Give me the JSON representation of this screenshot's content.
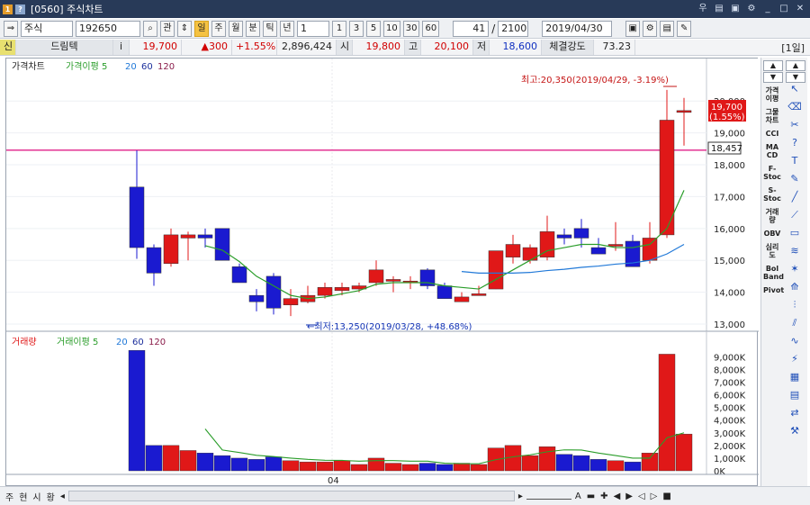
{
  "window": {
    "badge1": "1",
    "badge2": "?",
    "title": "[0560] 주식차트",
    "controls": [
      "우",
      "▤",
      "▣",
      "⚙",
      "_",
      "□",
      "✕"
    ]
  },
  "toolbar1": {
    "market": "주식",
    "code": "192650",
    "search_icon": "search-icon",
    "related": "관",
    "periods": [
      "일",
      "주",
      "월",
      "분",
      "틱",
      "년"
    ],
    "active_period": "일",
    "unit_value": "1",
    "quick_units": [
      "1",
      "3",
      "5",
      "10",
      "30",
      "60"
    ],
    "count": "41",
    "total": "2100",
    "date": "2019/04/30"
  },
  "toolbar2": {
    "flag": "신",
    "name": "드림텍",
    "info": "i",
    "price": "19,700",
    "change": "▲300",
    "rate": "+1.55%",
    "volume": "2,896,424",
    "open_label": "시",
    "open": "19,800",
    "high_label": "고",
    "high": "20,100",
    "low_label": "저",
    "low": "18,600",
    "strength_label": "체결강도",
    "strength": "73.23",
    "period_badge": "[1일]"
  },
  "price_panel": {
    "legend_main": "가격차트",
    "legend_ma": "가격이평 5",
    "ma20": "20",
    "ma60": "60",
    "ma120": "120",
    "y_ticks": [
      "20,000",
      "19,000",
      "18,000",
      "17,000",
      "16,000",
      "15,000",
      "14,000",
      "13,000"
    ],
    "current_tag": "19,700",
    "current_rate": "(1.55%)",
    "line_tag": "18,457",
    "high_note": "최고:20,350(2019/04/29, -3.19%)",
    "low_note": "←최저:13,250(2019/03/28, +48.68%)"
  },
  "volume_panel": {
    "legend_main": "거래량",
    "legend_ma": "거래이평 5",
    "ma20": "20",
    "ma60": "60",
    "ma120": "120",
    "y_ticks": [
      "9,000K",
      "8,000K",
      "7,000K",
      "6,000K",
      "5,000K",
      "4,000K",
      "3,000K",
      "2,000K",
      "1,000K",
      "0K"
    ]
  },
  "x_axis": {
    "tick": "04"
  },
  "chart_data": {
    "type": "candlestick",
    "ylim": [
      13000,
      20600
    ],
    "hline": 18457,
    "candles": [
      [
        17300,
        18450,
        15050,
        15400,
        9500
      ],
      [
        15400,
        15500,
        14200,
        14600,
        2000
      ],
      [
        14900,
        16000,
        14800,
        15800,
        2000
      ],
      [
        15700,
        15900,
        15000,
        15800,
        1600
      ],
      [
        15800,
        16000,
        15400,
        15700,
        1400
      ],
      [
        16000,
        16000,
        15000,
        15000,
        1200
      ],
      [
        14800,
        14900,
        14400,
        14300,
        1000
      ],
      [
        13900,
        14100,
        13400,
        13700,
        900
      ],
      [
        14500,
        14600,
        13300,
        13500,
        1100
      ],
      [
        13600,
        14100,
        13250,
        13800,
        800
      ],
      [
        13700,
        14200,
        13650,
        13900,
        700
      ],
      [
        13900,
        14300,
        13800,
        14150,
        700
      ],
      [
        14050,
        14300,
        13900,
        14150,
        800
      ],
      [
        14100,
        14300,
        14000,
        14200,
        500
      ],
      [
        14300,
        15000,
        14200,
        14700,
        1000
      ],
      [
        14400,
        14500,
        14000,
        14400,
        600
      ],
      [
        14300,
        14500,
        14100,
        14350,
        500
      ],
      [
        14700,
        14750,
        14100,
        14200,
        600
      ],
      [
        14200,
        14300,
        13800,
        13800,
        500
      ],
      [
        13700,
        14000,
        13700,
        13850,
        600
      ],
      [
        13900,
        14200,
        13900,
        13950,
        500
      ],
      [
        14100,
        15200,
        14100,
        15300,
        1800
      ],
      [
        15100,
        15800,
        14900,
        15500,
        2000
      ],
      [
        15000,
        15500,
        14900,
        15400,
        1200
      ],
      [
        15100,
        16400,
        15000,
        15900,
        1900
      ],
      [
        15800,
        16000,
        15500,
        15700,
        1300
      ],
      [
        16000,
        16300,
        15400,
        15700,
        1200
      ],
      [
        15400,
        15700,
        15200,
        15200,
        900
      ],
      [
        15500,
        16200,
        15300,
        15500,
        800
      ],
      [
        15600,
        15800,
        14900,
        14800,
        700
      ],
      [
        15000,
        16200,
        14900,
        15700,
        1400
      ],
      [
        15800,
        20350,
        15700,
        19400,
        9200
      ],
      [
        19700,
        20100,
        18600,
        19700,
        2900
      ]
    ],
    "ma5": [
      null,
      null,
      null,
      null,
      15460,
      15320,
      14960,
      14500,
      14200,
      13900,
      13800,
      13850,
      13950,
      14050,
      14250,
      14300,
      14300,
      14300,
      14200,
      14150,
      14100,
      14400,
      14700,
      15000,
      15300,
      15400,
      15500,
      15500,
      15400,
      15400,
      15500,
      16000,
      17200
    ],
    "ma20": [
      null,
      null,
      null,
      null,
      null,
      null,
      null,
      null,
      null,
      null,
      null,
      null,
      null,
      null,
      null,
      null,
      null,
      null,
      null,
      14650,
      14600,
      14600,
      14600,
      14620,
      14680,
      14720,
      14780,
      14820,
      14880,
      14920,
      15000,
      15200,
      15500
    ],
    "vol_ma5": [
      null,
      null,
      null,
      null,
      3300,
      1640,
      1440,
      1220,
      1120,
      1000,
      900,
      830,
      820,
      760,
      800,
      800,
      760,
      760,
      600,
      560,
      560,
      880,
      1100,
      1260,
      1500,
      1650,
      1640,
      1400,
      1200,
      1000,
      1000,
      2600,
      3000
    ]
  },
  "right_toolbar": {
    "labels": [
      "가격",
      "이평",
      "그물",
      "차트",
      "CCI",
      "MA",
      "CD",
      "F-",
      "Stoc",
      "S-",
      "Stoc",
      "거래",
      "량",
      "OBV",
      "심리",
      "도",
      "Bol",
      "Band",
      "Pivot"
    ]
  },
  "bottom_bar": {
    "left_buttons": [
      "주",
      "현",
      "시",
      "황"
    ],
    "zoom_labels": [
      "A",
      "▬",
      "✚",
      "◀",
      "▶",
      "◁",
      "▷",
      "■"
    ]
  }
}
